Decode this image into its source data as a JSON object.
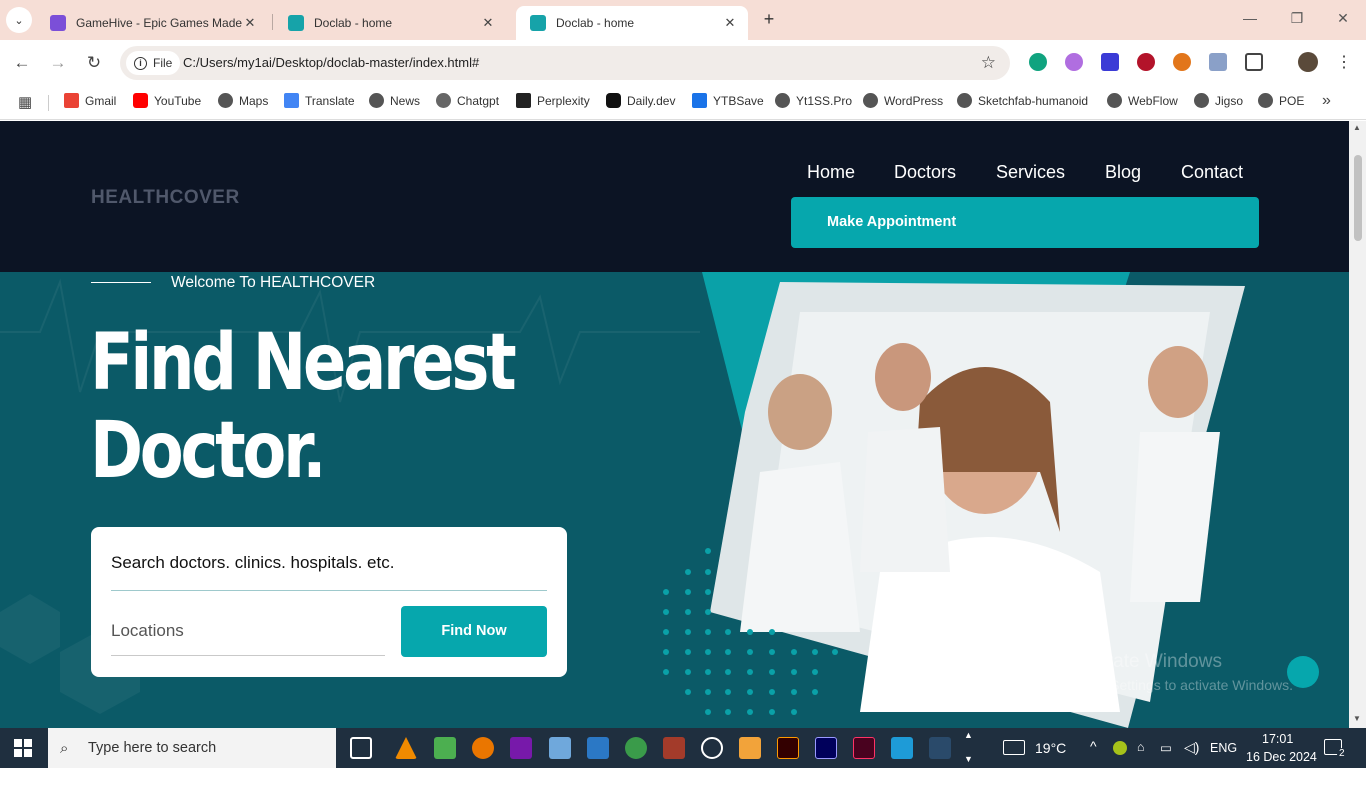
{
  "browser": {
    "tabs": [
      {
        "title": "GameHive - Epic Games Made F",
        "active": false,
        "favicon_color": "#7b4fd8"
      },
      {
        "title": "Doclab - home",
        "active": false,
        "favicon_color": "#16a3a9"
      },
      {
        "title": "Doclab - home",
        "active": true,
        "favicon_color": "#16a3a9"
      }
    ],
    "new_tab_icon": "+",
    "site_chip": "File",
    "url": "C:/Users/my1ai/Desktop/doclab-master/index.html#",
    "bookmarks": [
      {
        "label": "Gmail",
        "color": "#ea4335"
      },
      {
        "label": "YouTube",
        "color": "#ff0000"
      },
      {
        "label": "Maps",
        "color": "#555555"
      },
      {
        "label": "Translate",
        "color": "#4285f4"
      },
      {
        "label": "News",
        "color": "#555555"
      },
      {
        "label": "Chatgpt",
        "color": "#555555"
      },
      {
        "label": "Perplexity",
        "color": "#222222"
      },
      {
        "label": "Daily.dev",
        "color": "#111111"
      },
      {
        "label": "YTBSave",
        "color": "#1a73e8"
      },
      {
        "label": "Yt1SS.Pro",
        "color": "#555555"
      },
      {
        "label": "WordPress",
        "color": "#555555"
      },
      {
        "label": "Sketchfab-humanoid",
        "color": "#555555"
      },
      {
        "label": "WebFlow",
        "color": "#555555"
      },
      {
        "label": "Jigso",
        "color": "#555555"
      },
      {
        "label": "POE",
        "color": "#555555"
      }
    ]
  },
  "site": {
    "logo": "HEALTHCOVER",
    "nav": [
      "Home",
      "Doctors",
      "Services",
      "Blog",
      "Contact"
    ],
    "appointment_button": "Make Appointment",
    "welcome": "Welcome To HEALTHCOVER",
    "headline_line1": "Find Nearest",
    "headline_line2": "Doctor.",
    "search_placeholder": "Search doctors. clinics. hospitals. etc.",
    "location_placeholder": "Locations",
    "find_button": "Find Now",
    "accent_color": "#06a7ad",
    "hero_bg": "#0b5a67",
    "header_bg": "#0c1424"
  },
  "watermark": {
    "line1": "Activate Windows",
    "line2": "Go to Settings to activate Windows."
  },
  "taskbar": {
    "search_placeholder": "Type here to search",
    "weather": "19°C",
    "language": "ENG",
    "time": "17:01",
    "date": "16 Dec 2024",
    "notifications": "2"
  }
}
